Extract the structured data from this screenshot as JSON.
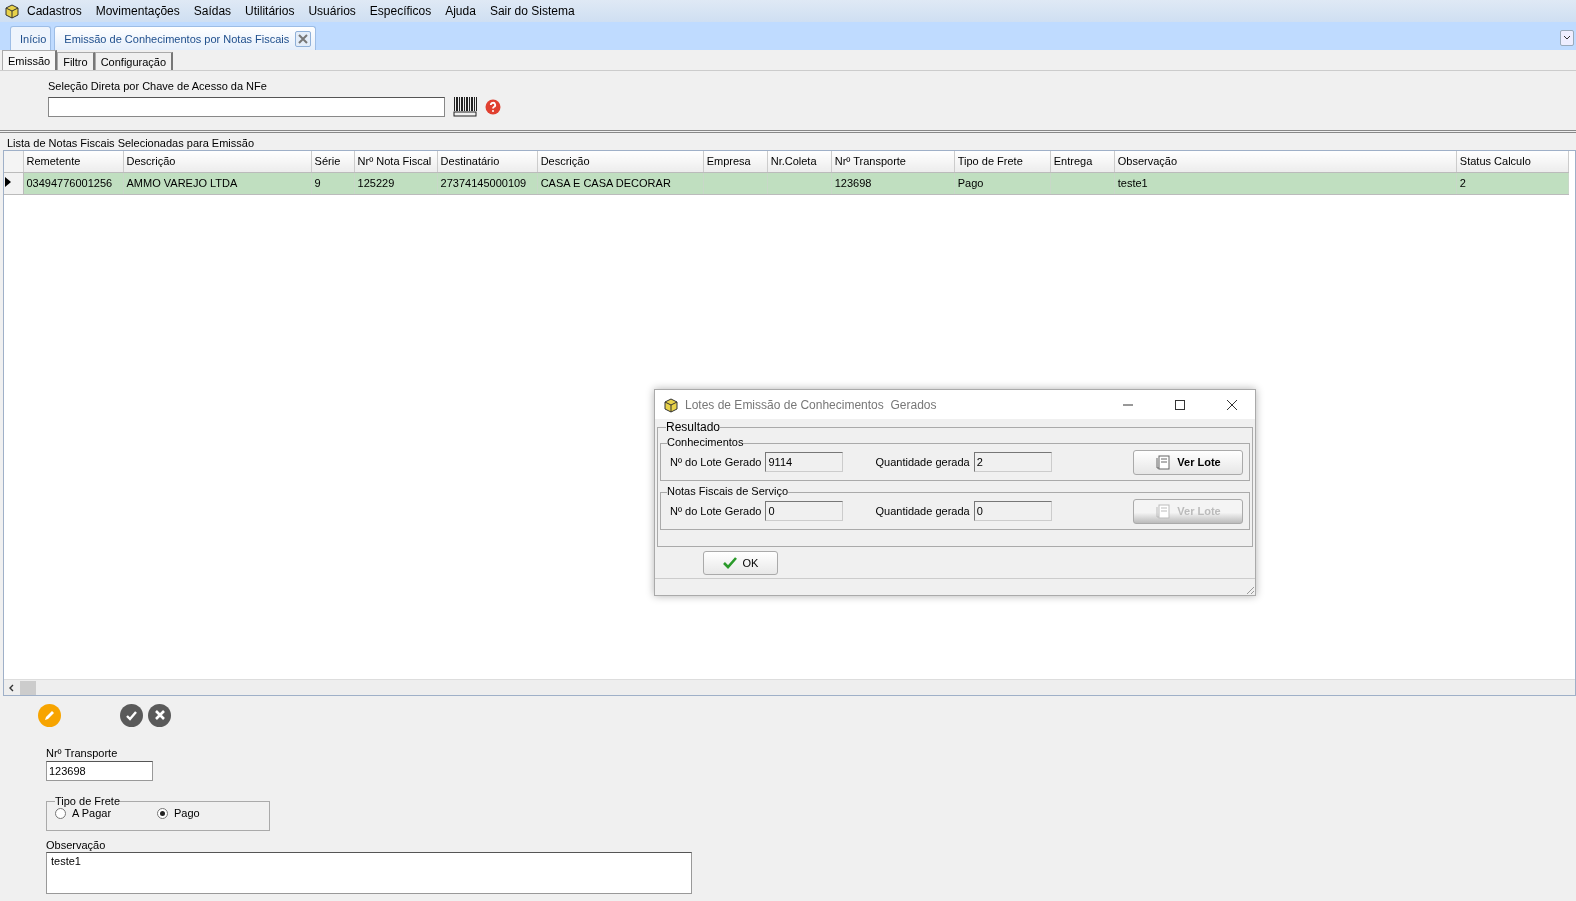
{
  "menu": [
    "Cadastros",
    "Movimentações",
    "Saídas",
    "Utilitários",
    "Usuários",
    "Específicos",
    "Ajuda",
    "Sair do Sistema"
  ],
  "doc_tabs": [
    {
      "label": "Início",
      "selected": false,
      "closable": false
    },
    {
      "label": "Emissão de Conhecimentos por Notas Fiscais",
      "selected": true,
      "closable": true
    }
  ],
  "sub_tabs": [
    {
      "label": "Emissão",
      "selected": true
    },
    {
      "label": "Filtro",
      "selected": false
    },
    {
      "label": "Configuração",
      "selected": false
    }
  ],
  "nfe_key": {
    "label": "Seleção Direta por Chave de Acesso da NFe"
  },
  "list": {
    "title": "Lista de Notas Fiscais Selecionadas para Emissão",
    "columns": [
      "Remetente",
      "Descrição",
      "Série",
      "Nrº Nota Fiscal",
      "Destinatário",
      "Descrição",
      "Empresa",
      "Nr.Coleta",
      "Nrº Transporte",
      "Tipo de Frete",
      "Entrega",
      "Observação",
      "Status Calculo"
    ],
    "rows": [
      {
        "selected": true,
        "cells": [
          "03494776001256",
          "AMMO VAREJO LTDA",
          "9",
          "125229",
          "27374145000109",
          "CASA E CASA DECORAR",
          "",
          "",
          "123698",
          "Pago",
          "",
          "teste1",
          "2"
        ]
      }
    ]
  },
  "edit_form": {
    "transporte": {
      "label": "Nrº Transporte",
      "value": "123698"
    },
    "frete": {
      "label": "Tipo de Frete",
      "options": [
        {
          "label": "A Pagar",
          "selected": false
        },
        {
          "label": "Pago",
          "selected": true
        }
      ]
    },
    "observacao": {
      "label": "Observação",
      "value": "teste1"
    }
  },
  "dialog": {
    "title": "Lotes de Emissão de Conhecimentos  Gerados",
    "group": "Resultado",
    "sections": [
      {
        "title": "Conhecimentos",
        "lote_label": "Nº do Lote Gerado",
        "lote": "9114",
        "qtd_label": "Quantidade gerada",
        "qtd": "2",
        "button": "Ver Lote",
        "disabled": false
      },
      {
        "title": "Notas Fiscais de Serviço",
        "lote_label": "Nº do Lote Gerado",
        "lote": "0",
        "qtd_label": "Quantidade gerada",
        "qtd": "0",
        "button": "Ver Lote",
        "disabled": true
      }
    ],
    "ok": "OK"
  }
}
